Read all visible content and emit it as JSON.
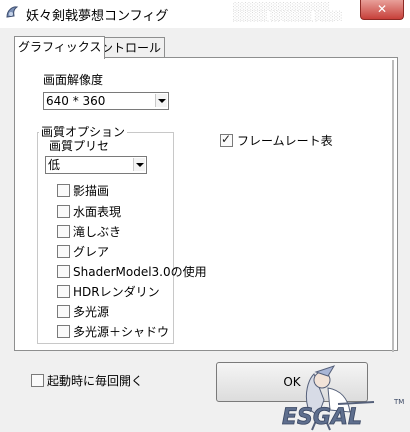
{
  "window": {
    "title": "妖々剣戟夢想コンフィグ",
    "close_label": "✕"
  },
  "tabs": [
    {
      "label": "グラフィックス",
      "active": true
    },
    {
      "label": "コントロール",
      "active": false
    }
  ],
  "resolution": {
    "label": "画面解像度",
    "value": "640 * 360"
  },
  "quality_group": {
    "title": "画質オプション",
    "preset_label": "画質プリセ",
    "preset_value": "低"
  },
  "options": [
    {
      "label": "影描画",
      "checked": false
    },
    {
      "label": "水面表現",
      "checked": false
    },
    {
      "label": "滝しぶき",
      "checked": false
    },
    {
      "label": "グレア",
      "checked": false
    },
    {
      "label": "ShaderModel3.0の使用",
      "checked": false
    },
    {
      "label": "HDRレンダリン",
      "checked": false
    },
    {
      "label": "多光源",
      "checked": false
    },
    {
      "label": "多光源＋シャドウ",
      "checked": false
    }
  ],
  "framerate": {
    "label": "フレームレート表",
    "checked": true
  },
  "startup": {
    "label": "起動時に毎回開く",
    "checked": false
  },
  "ok_button": {
    "label": "OK"
  },
  "watermark": {
    "text": "ESGAL",
    "tm": "TM"
  }
}
